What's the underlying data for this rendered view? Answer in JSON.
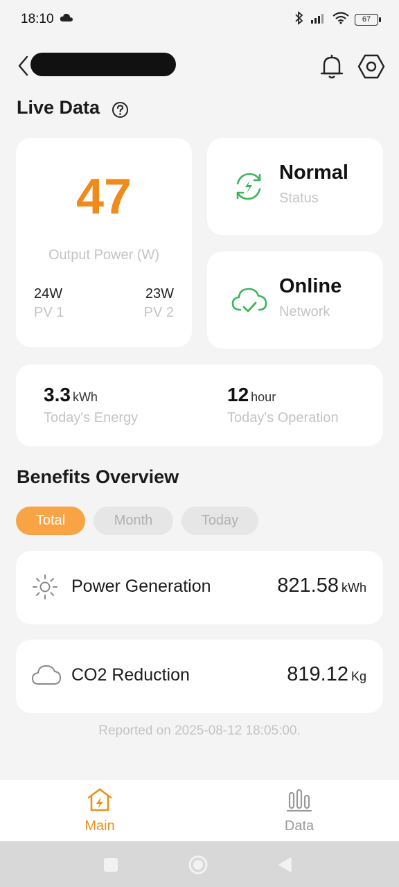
{
  "status_bar": {
    "time": "18:10",
    "battery": "67"
  },
  "header": {
    "back_icon": "chevron-left-icon",
    "title_redacted": true
  },
  "live_data": {
    "title": "Live Data",
    "output_power": {
      "value": "47",
      "label": "Output Power (W)"
    },
    "pv1": {
      "value": "24W",
      "label": "PV 1"
    },
    "pv2": {
      "value": "23W",
      "label": "PV 2"
    },
    "status": {
      "value": "Normal",
      "label": "Status"
    },
    "network": {
      "value": "Online",
      "label": "Network"
    },
    "energy": {
      "value": "3.3",
      "unit": "kWh",
      "label": "Today's Energy"
    },
    "operation": {
      "value": "12",
      "unit": "hour",
      "label": "Today's Operation"
    }
  },
  "benefits": {
    "title": "Benefits Overview",
    "tabs": [
      "Total",
      "Month",
      "Today"
    ],
    "active_tab": "Total",
    "power_generation": {
      "label": "Power Generation",
      "value": "821.58",
      "unit": "kWh"
    },
    "co2_reduction": {
      "label": "CO2 Reduction",
      "value": "819.12",
      "unit": "Kg"
    },
    "reported": "Reported on 2025-08-12 18:05:00."
  },
  "bottom_nav": {
    "main": "Main",
    "data": "Data"
  },
  "colors": {
    "accent": "#f08a1c",
    "green": "#3cb55a",
    "tab_active": "#f8a445"
  }
}
